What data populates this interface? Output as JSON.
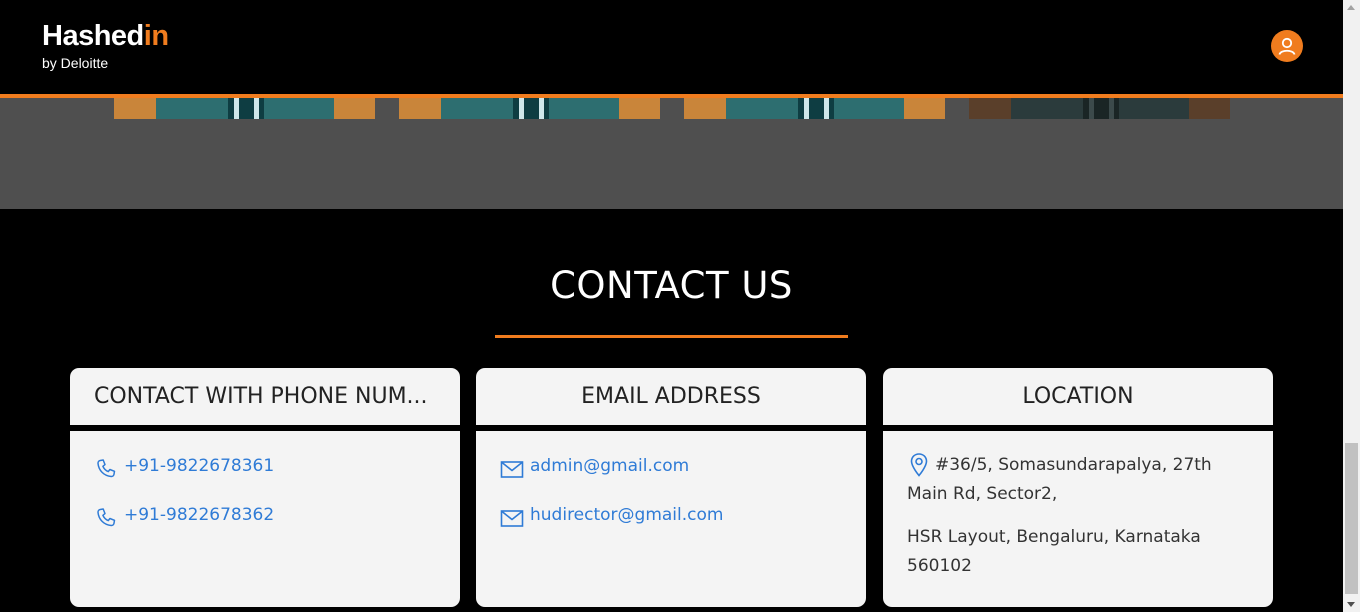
{
  "header": {
    "logo_main": "Hashed",
    "logo_accent": "in",
    "logo_sub": "by Deloitte",
    "avatar_icon": "user-icon"
  },
  "colors": {
    "accent": "#f07c1e",
    "link": "#2f7bd6",
    "card_bg": "#f4f4f4",
    "band_bg": "#4f4f4f"
  },
  "contact": {
    "title": "CONTACT US",
    "cards": [
      {
        "heading": "CONTACT WITH PHONE NUM...",
        "icon": "phone-icon",
        "items": [
          "+91-9822678361",
          "+91-9822678362"
        ]
      },
      {
        "heading": "EMAIL ADDRESS",
        "icon": "mail-icon",
        "items": [
          "admin@gmail.com",
          "hudirector@gmail.com"
        ]
      },
      {
        "heading": "LOCATION",
        "icon": "location-pin-icon",
        "address_line1": "#36/5, Somasundarapalya, 27th Main Rd, Sector2,",
        "address_line2": "HSR Layout, Bengaluru, Karnataka 560102"
      }
    ]
  }
}
